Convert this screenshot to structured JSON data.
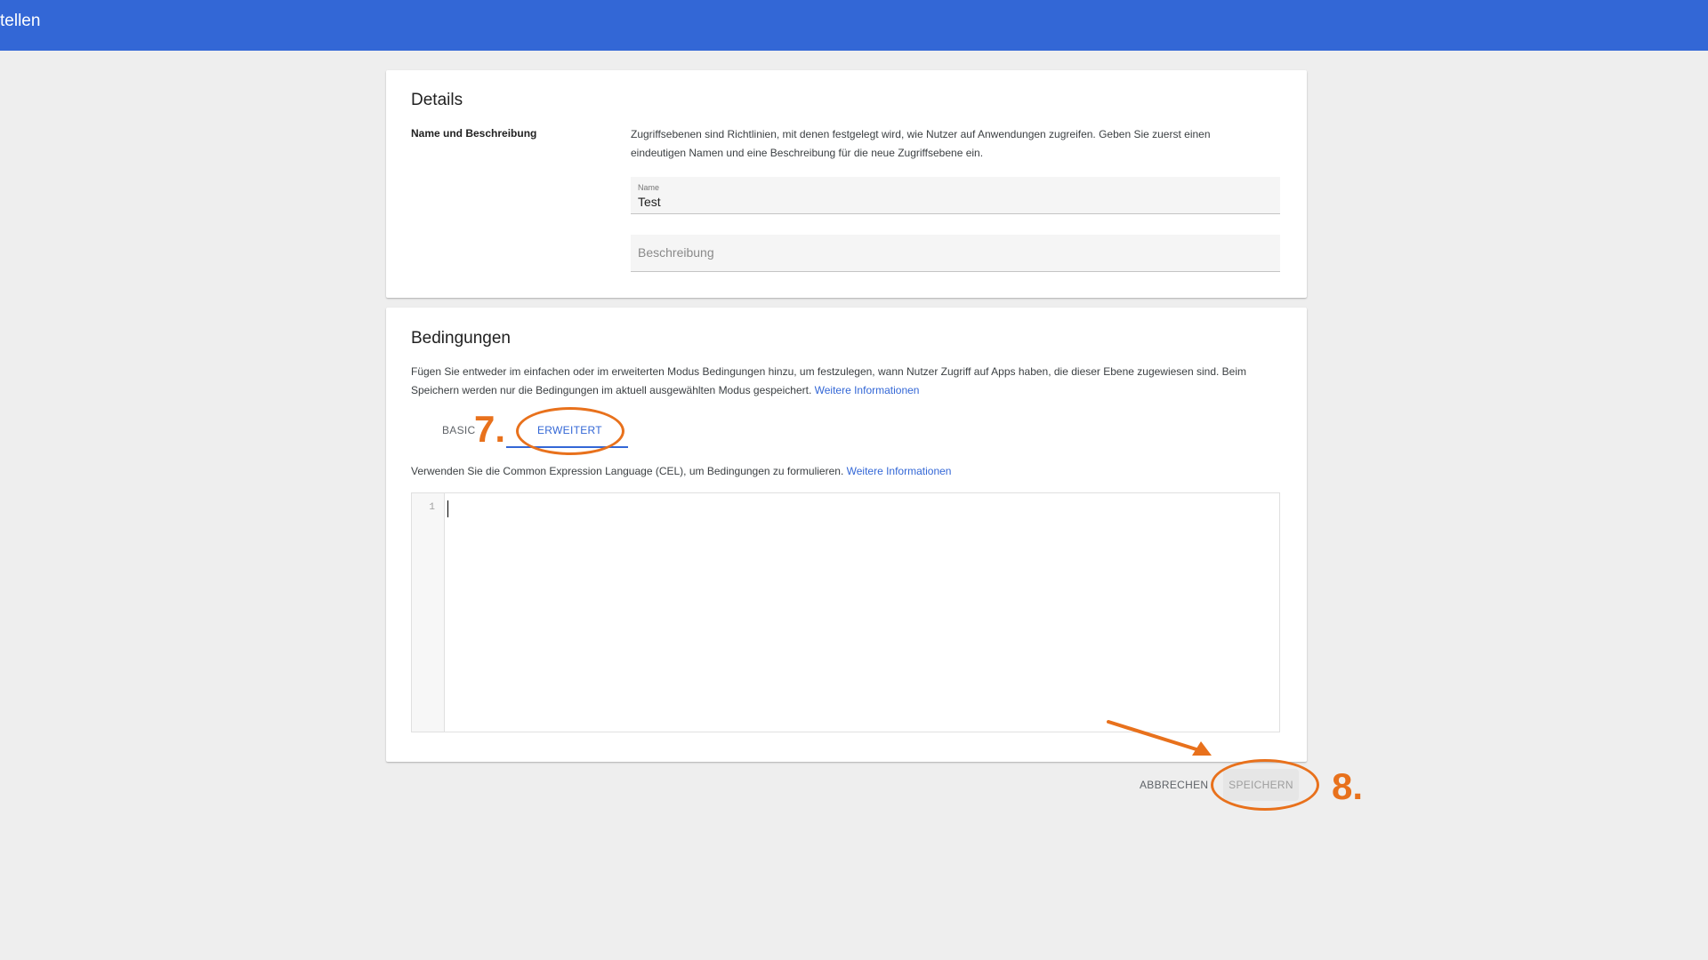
{
  "appbar": {
    "title": "tellen",
    "color": "#3367d6"
  },
  "details": {
    "title": "Details",
    "section_label": "Name und Beschreibung",
    "description": "Zugriffsebenen sind Richtlinien, mit denen festgelegt wird, wie Nutzer auf Anwendungen zugreifen. Geben Sie zuerst einen eindeutigen Namen und eine Beschreibung für die neue Zugriffsebene ein.",
    "name_field": {
      "label": "Name",
      "value": "Test"
    },
    "description_field": {
      "placeholder": "Beschreibung",
      "value": ""
    }
  },
  "conditions": {
    "title": "Bedingungen",
    "description": "Fügen Sie entweder im einfachen oder im erweiterten Modus Bedingungen hinzu, um festzulegen, wann Nutzer Zugriff auf Apps haben, die dieser Ebene zugewiesen sind. Beim Speichern werden nur die Bedingungen im aktuell ausgewählten Modus gespeichert.",
    "link": "Weitere Informationen",
    "tabs": [
      {
        "label": "BASIC",
        "active": false
      },
      {
        "label": "ERWEITERT",
        "active": true
      }
    ],
    "cel_description": "Verwenden Sie die Common Expression Language (CEL), um Bedingungen zu formulieren.",
    "cel_link": "Weitere Informationen",
    "editor": {
      "line_number": "1",
      "content": ""
    }
  },
  "actions": {
    "cancel_label": "ABBRECHEN",
    "save_label": "SPEICHERN"
  },
  "annotations": {
    "step_7": "7.",
    "step_8": "8.",
    "color": "#e8711c"
  }
}
